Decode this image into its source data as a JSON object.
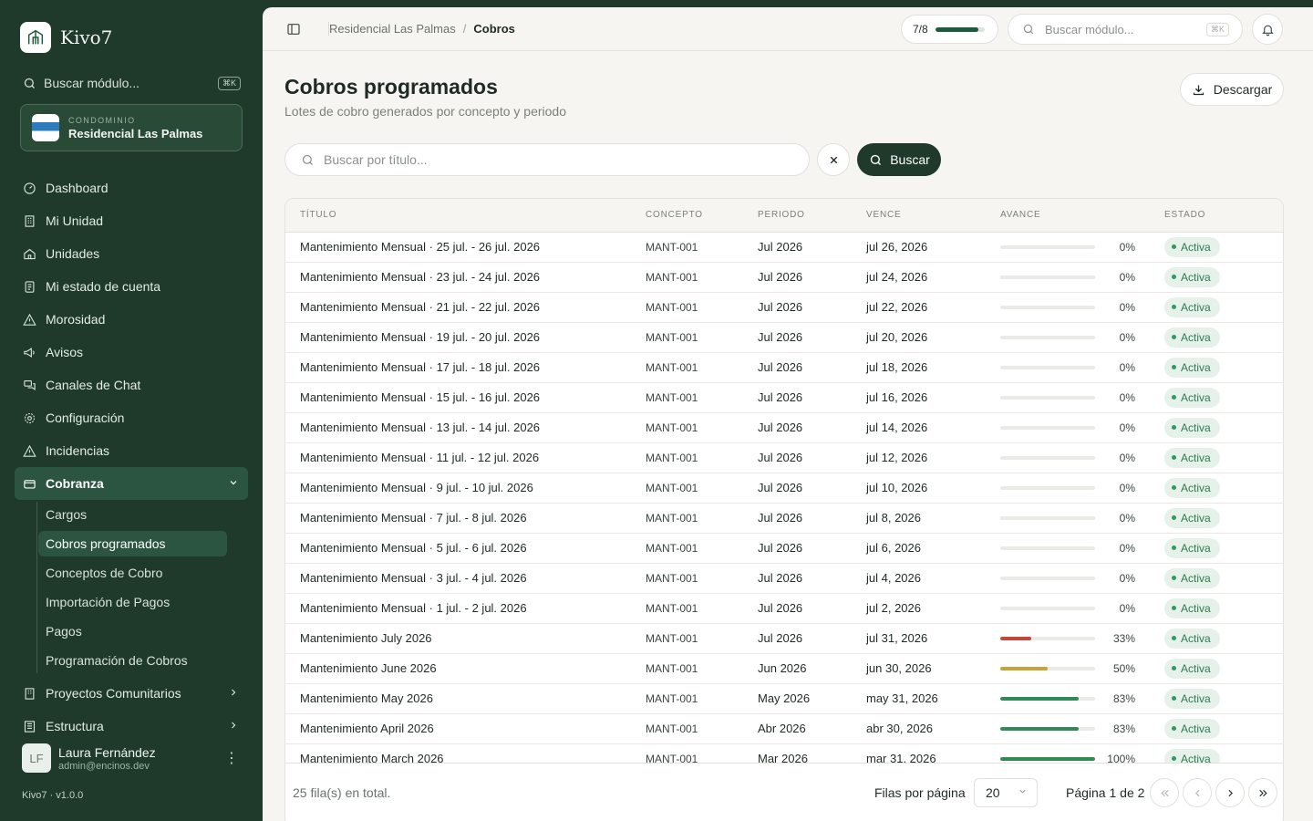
{
  "app": {
    "name": "Kivo7",
    "version": "Kivo7 · v1.0.0"
  },
  "sidebar": {
    "search_placeholder": "Buscar módulo...",
    "search_kbd": "⌘K",
    "condo": {
      "label": "CONDOMINIO",
      "name": "Residencial Las Palmas"
    },
    "items": [
      {
        "label": "Dashboard",
        "icon": "gauge-icon"
      },
      {
        "label": "Mi Unidad",
        "icon": "building-icon"
      },
      {
        "label": "Unidades",
        "icon": "home-icon"
      },
      {
        "label": "Mi estado de cuenta",
        "icon": "receipt-icon"
      },
      {
        "label": "Morosidad",
        "icon": "alert-triangle-icon"
      },
      {
        "label": "Avisos",
        "icon": "megaphone-icon"
      },
      {
        "label": "Canales de Chat",
        "icon": "chat-icon"
      },
      {
        "label": "Configuración",
        "icon": "gear-icon"
      },
      {
        "label": "Incidencias",
        "icon": "alert-triangle-icon"
      }
    ],
    "cobranza": {
      "label": "Cobranza",
      "sub": [
        "Cargos",
        "Cobros programados",
        "Conceptos de Cobro",
        "Importación de Pagos",
        "Pagos",
        "Programación de Cobros"
      ]
    },
    "after": [
      {
        "label": "Proyectos Comunitarios",
        "icon": "building-icon"
      },
      {
        "label": "Estructura",
        "icon": "structure-icon"
      }
    ],
    "user": {
      "initials": "LF",
      "name": "Laura Fernández",
      "email": "admin@encinos.dev"
    }
  },
  "topbar": {
    "breadcrumb": [
      "Residencial Las Palmas",
      "Cobros"
    ],
    "progress_label": "7/8",
    "progress_value": 0.875,
    "search_placeholder": "Buscar módulo...",
    "search_kbd": "⌘K"
  },
  "page": {
    "title": "Cobros programados",
    "subtitle": "Lotes de cobro generados por concepto y periodo",
    "download_label": "Descargar",
    "search_placeholder": "Buscar por título...",
    "search_button": "Buscar"
  },
  "table": {
    "headers": [
      "TÍTULO",
      "CONCEPTO",
      "PERIODO",
      "VENCE",
      "AVANCE",
      "ESTADO"
    ],
    "rows": [
      {
        "title": "Mantenimiento Mensual · 25 jul. - 26 jul. 2026",
        "concept": "MANT-001",
        "period": "Jul 2026",
        "due": "jul 26, 2026",
        "progress": 0,
        "pct": "0%",
        "status": "Activa"
      },
      {
        "title": "Mantenimiento Mensual · 23 jul. - 24 jul. 2026",
        "concept": "MANT-001",
        "period": "Jul 2026",
        "due": "jul 24, 2026",
        "progress": 0,
        "pct": "0%",
        "status": "Activa"
      },
      {
        "title": "Mantenimiento Mensual · 21 jul. - 22 jul. 2026",
        "concept": "MANT-001",
        "period": "Jul 2026",
        "due": "jul 22, 2026",
        "progress": 0,
        "pct": "0%",
        "status": "Activa"
      },
      {
        "title": "Mantenimiento Mensual · 19 jul. - 20 jul. 2026",
        "concept": "MANT-001",
        "period": "Jul 2026",
        "due": "jul 20, 2026",
        "progress": 0,
        "pct": "0%",
        "status": "Activa"
      },
      {
        "title": "Mantenimiento Mensual · 17 jul. - 18 jul. 2026",
        "concept": "MANT-001",
        "period": "Jul 2026",
        "due": "jul 18, 2026",
        "progress": 0,
        "pct": "0%",
        "status": "Activa"
      },
      {
        "title": "Mantenimiento Mensual · 15 jul. - 16 jul. 2026",
        "concept": "MANT-001",
        "period": "Jul 2026",
        "due": "jul 16, 2026",
        "progress": 0,
        "pct": "0%",
        "status": "Activa"
      },
      {
        "title": "Mantenimiento Mensual · 13 jul. - 14 jul. 2026",
        "concept": "MANT-001",
        "period": "Jul 2026",
        "due": "jul 14, 2026",
        "progress": 0,
        "pct": "0%",
        "status": "Activa"
      },
      {
        "title": "Mantenimiento Mensual · 11 jul. - 12 jul. 2026",
        "concept": "MANT-001",
        "period": "Jul 2026",
        "due": "jul 12, 2026",
        "progress": 0,
        "pct": "0%",
        "status": "Activa"
      },
      {
        "title": "Mantenimiento Mensual · 9 jul. - 10 jul. 2026",
        "concept": "MANT-001",
        "period": "Jul 2026",
        "due": "jul 10, 2026",
        "progress": 0,
        "pct": "0%",
        "status": "Activa"
      },
      {
        "title": "Mantenimiento Mensual · 7 jul. - 8 jul. 2026",
        "concept": "MANT-001",
        "period": "Jul 2026",
        "due": "jul 8, 2026",
        "progress": 0,
        "pct": "0%",
        "status": "Activa"
      },
      {
        "title": "Mantenimiento Mensual · 5 jul. - 6 jul. 2026",
        "concept": "MANT-001",
        "period": "Jul 2026",
        "due": "jul 6, 2026",
        "progress": 0,
        "pct": "0%",
        "status": "Activa"
      },
      {
        "title": "Mantenimiento Mensual · 3 jul. - 4 jul. 2026",
        "concept": "MANT-001",
        "period": "Jul 2026",
        "due": "jul 4, 2026",
        "progress": 0,
        "pct": "0%",
        "status": "Activa"
      },
      {
        "title": "Mantenimiento Mensual · 1 jul. - 2 jul. 2026",
        "concept": "MANT-001",
        "period": "Jul 2026",
        "due": "jul 2, 2026",
        "progress": 0,
        "pct": "0%",
        "status": "Activa"
      },
      {
        "title": "Mantenimiento July 2026",
        "concept": "MANT-001",
        "period": "Jul 2026",
        "due": "jul 31, 2026",
        "progress": 33,
        "pct": "33%",
        "status": "Activa"
      },
      {
        "title": "Mantenimiento June 2026",
        "concept": "MANT-001",
        "period": "Jun 2026",
        "due": "jun 30, 2026",
        "progress": 50,
        "pct": "50%",
        "status": "Activa"
      },
      {
        "title": "Mantenimiento May 2026",
        "concept": "MANT-001",
        "period": "May 2026",
        "due": "may 31, 2026",
        "progress": 83,
        "pct": "83%",
        "status": "Activa"
      },
      {
        "title": "Mantenimiento April 2026",
        "concept": "MANT-001",
        "period": "Abr 2026",
        "due": "abr 30, 2026",
        "progress": 83,
        "pct": "83%",
        "status": "Activa"
      },
      {
        "title": "Mantenimiento March 2026",
        "concept": "MANT-001",
        "period": "Mar 2026",
        "due": "mar 31, 2026",
        "progress": 100,
        "pct": "100%",
        "status": "Activa"
      }
    ]
  },
  "colors": {
    "low": "#c0473a",
    "mid": "#c9a23a",
    "high": "#2f8a58"
  },
  "footer": {
    "total": "25 fila(s) en total.",
    "rows_per_page_label": "Filas por página",
    "rows_per_page": "20",
    "page_info": "Página 1 de 2"
  }
}
